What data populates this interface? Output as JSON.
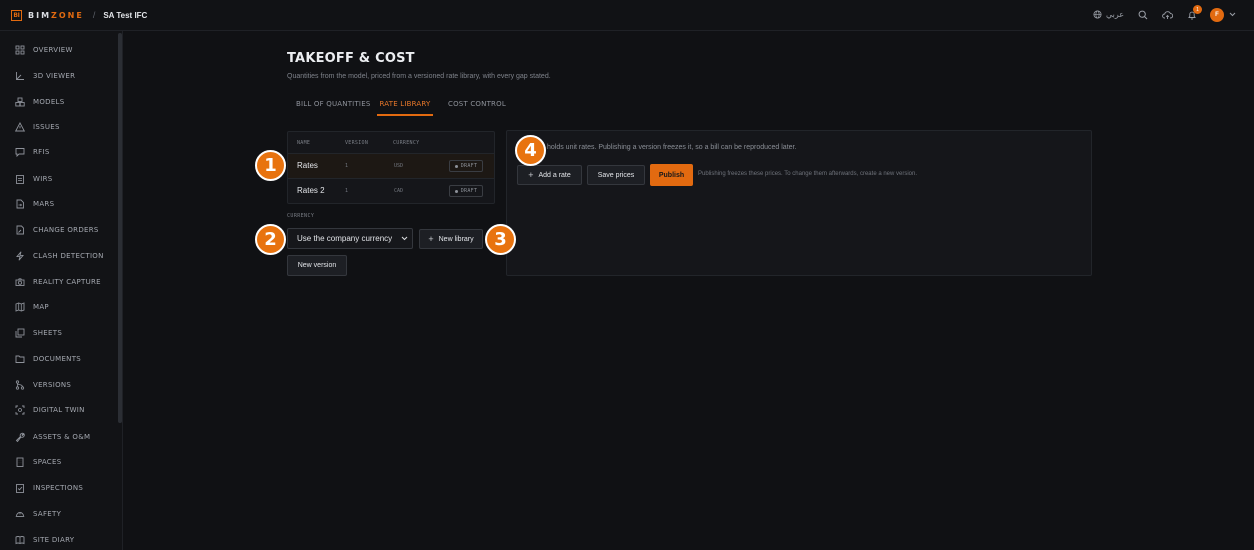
{
  "topbar": {
    "logo_mark": "BI",
    "logo_prefix": "BIM",
    "logo_suffix": "ZONE",
    "separator": "/",
    "project": "SA Test IFC",
    "language": "عربي",
    "notification_count": "1",
    "avatar_initial": "F",
    "accent_color": "#e26a10"
  },
  "sidebar": {
    "items": [
      {
        "label": "OVERVIEW",
        "icon": "grid-icon"
      },
      {
        "label": "3D VIEWER",
        "icon": "axes-icon"
      },
      {
        "label": "MODELS",
        "icon": "boxes-icon"
      },
      {
        "label": "ISSUES",
        "icon": "warning-icon"
      },
      {
        "label": "RFIS",
        "icon": "chat-icon"
      },
      {
        "label": "WIRS",
        "icon": "clipboard-icon"
      },
      {
        "label": "MARS",
        "icon": "file-arrow-icon"
      },
      {
        "label": "CHANGE ORDERS",
        "icon": "document-edit-icon"
      },
      {
        "label": "CLASH DETECTION",
        "icon": "lightning-icon"
      },
      {
        "label": "REALITY CAPTURE",
        "icon": "camera-icon"
      },
      {
        "label": "MAP",
        "icon": "map-icon"
      },
      {
        "label": "SHEETS",
        "icon": "sheets-icon"
      },
      {
        "label": "DOCUMENTS",
        "icon": "folder-icon"
      },
      {
        "label": "VERSIONS",
        "icon": "branch-icon"
      },
      {
        "label": "DIGITAL TWIN",
        "icon": "scan-icon"
      },
      {
        "label": "ASSETS & O&M",
        "icon": "wrench-icon"
      },
      {
        "label": "SPACES",
        "icon": "building-icon"
      },
      {
        "label": "INSPECTIONS",
        "icon": "checklist-icon"
      },
      {
        "label": "SAFETY",
        "icon": "hardhat-icon"
      },
      {
        "label": "SITE DIARY",
        "icon": "book-icon"
      }
    ]
  },
  "main": {
    "title": "TAKEOFF & COST",
    "subtitle": "Quantities from the model, priced from a versioned rate library, with every gap stated.",
    "tabs": [
      {
        "label": "BILL OF QUANTITIES",
        "active": false
      },
      {
        "label": "RATE LIBRARY",
        "active": true
      },
      {
        "label": "COST CONTROL",
        "active": false
      }
    ]
  },
  "library_table": {
    "headers": {
      "name": "NAME",
      "version": "VERSION",
      "currency": "CURRENCY"
    },
    "rows": [
      {
        "name": "Rates",
        "version": "1",
        "currency": "USD",
        "status": "DRAFT"
      },
      {
        "name": "Rates 2",
        "version": "1",
        "currency": "CAD",
        "status": "DRAFT"
      }
    ]
  },
  "currency_form": {
    "label": "CURRENCY",
    "selected": "Use the company currency",
    "new_library_label": "New library",
    "new_version_label": "New version"
  },
  "detail_panel": {
    "description": "holds unit rates. Publishing a version freezes it, so a bill can be reproduced later.",
    "add_rate_label": "Add a rate",
    "save_prices_label": "Save prices",
    "publish_label": "Publish",
    "hint": "Publishing freezes these prices. To change them afterwards, create a new version."
  },
  "markers": [
    "1",
    "2",
    "3",
    "4"
  ]
}
